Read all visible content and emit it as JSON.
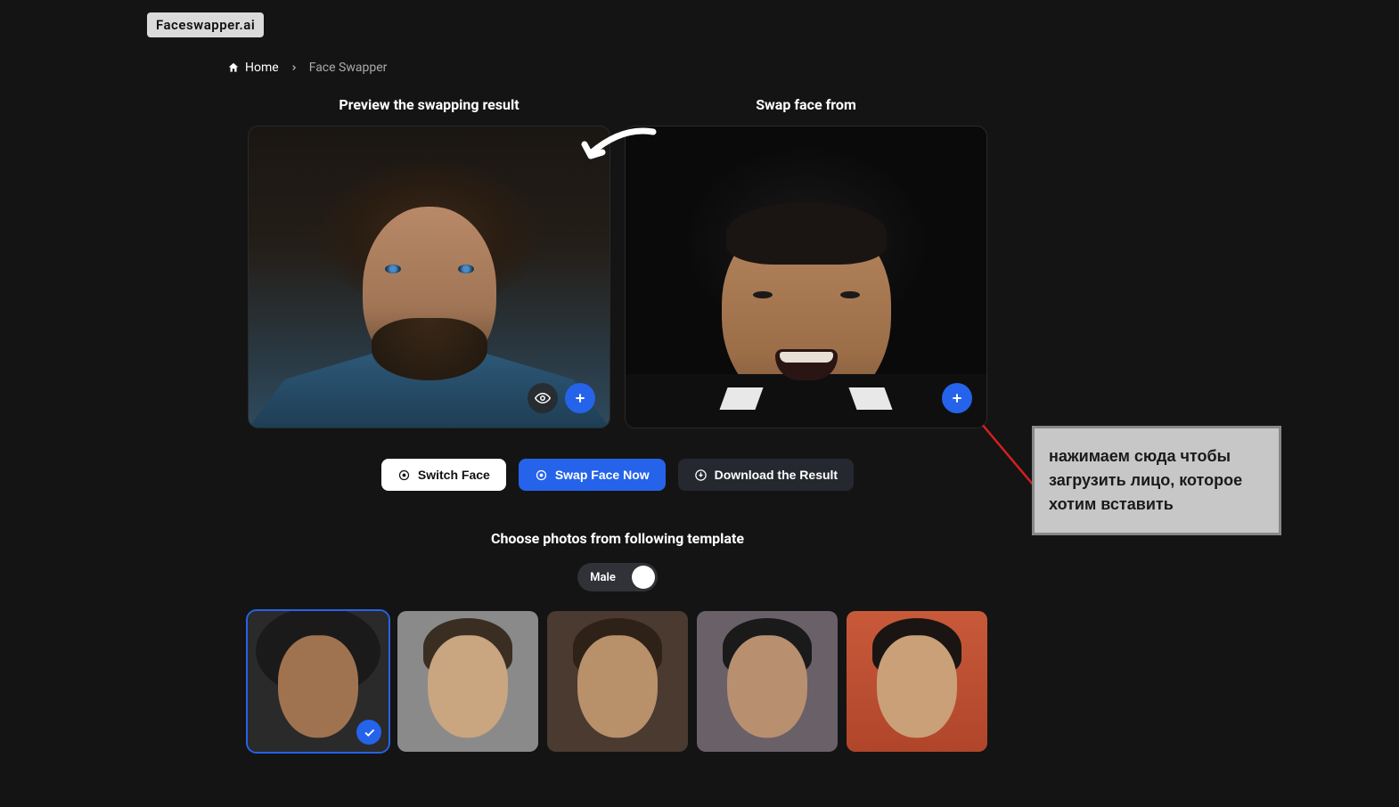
{
  "brand": "Faceswapper.ai",
  "breadcrumb": {
    "home": "Home",
    "current": "Face Swapper"
  },
  "panels": {
    "preview_title": "Preview the swapping result",
    "source_title": "Swap face from"
  },
  "actions": {
    "switch": "Switch Face",
    "swap": "Swap Face Now",
    "download": "Download the Result"
  },
  "templates": {
    "title": "Choose photos from following template",
    "toggle_label": "Male"
  },
  "annotation": "нажимаем сюда чтобы загрузить лицо, которое хотим вставить"
}
